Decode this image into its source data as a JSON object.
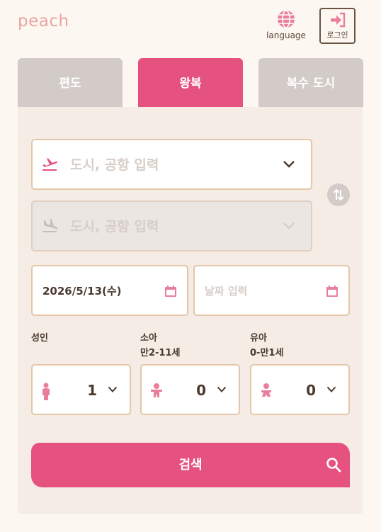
{
  "header": {
    "logo_text": "peach",
    "language_label": "language",
    "login_label": "로그인"
  },
  "tabs": [
    {
      "label": "편도",
      "active": false
    },
    {
      "label": "왕복",
      "active": true
    },
    {
      "label": "복수 도시",
      "active": false
    }
  ],
  "route": {
    "origin_placeholder": "도시, 공항 입력",
    "destination_placeholder": "도시, 공항 입력"
  },
  "dates": {
    "departure_value": "2026/5/13(수)",
    "return_placeholder": "날짜 입력"
  },
  "passengers": {
    "adult": {
      "label": "성인",
      "sub": "",
      "count": "1"
    },
    "child": {
      "label": "소아",
      "sub": "만2-11세",
      "count": "0"
    },
    "infant": {
      "label": "유아",
      "sub": "0-만1세",
      "count": "0"
    }
  },
  "search_label": "검색",
  "colors": {
    "accent": "#e5527f",
    "logo": "#e8a5a0",
    "tab_inactive": "#d3cbc7",
    "field_border": "#e3c7a8",
    "panel_bg": "#f5ece5"
  }
}
